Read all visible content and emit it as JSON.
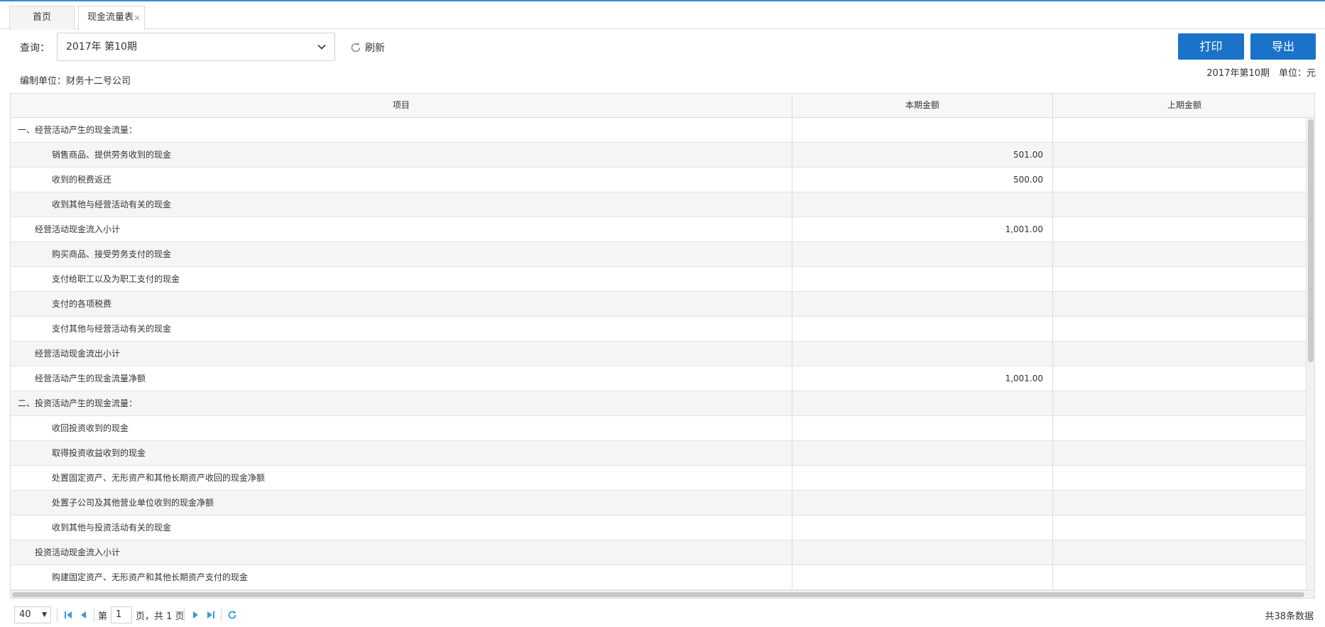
{
  "tabs": [
    {
      "label": "首页"
    },
    {
      "label": "现金流量表",
      "close": "×"
    }
  ],
  "query": {
    "label": "查询：",
    "selected": "2017年 第10期",
    "refresh_label": "刷新"
  },
  "actions": {
    "print_label": "打印",
    "export_label": "导出"
  },
  "unit_text": "编制单位：财务十二号公司",
  "period_info": "2017年第10期　单位：元",
  "table": {
    "headers": [
      "项目",
      "本期金额",
      "上期金额"
    ],
    "rows": [
      {
        "item": "一、经营活动产生的现金流量：",
        "level": 0,
        "current": "",
        "previous": ""
      },
      {
        "item": "销售商品、提供劳务收到的现金",
        "level": 2,
        "current": "501.00",
        "previous": ""
      },
      {
        "item": "收到的税费返还",
        "level": 2,
        "current": "500.00",
        "previous": ""
      },
      {
        "item": "收到其他与经营活动有关的现金",
        "level": 2,
        "current": "",
        "previous": ""
      },
      {
        "item": "经营活动现金流入小计",
        "level": 1,
        "current": "1,001.00",
        "previous": ""
      },
      {
        "item": "购买商品、接受劳务支付的现金",
        "level": 2,
        "current": "",
        "previous": ""
      },
      {
        "item": "支付给职工以及为职工支付的现金",
        "level": 2,
        "current": "",
        "previous": ""
      },
      {
        "item": "支付的各项税费",
        "level": 2,
        "current": "",
        "previous": ""
      },
      {
        "item": "支付其他与经营活动有关的现金",
        "level": 2,
        "current": "",
        "previous": ""
      },
      {
        "item": "经营活动现金流出小计",
        "level": 1,
        "current": "",
        "previous": ""
      },
      {
        "item": "经营活动产生的现金流量净额",
        "level": 1,
        "current": "1,001.00",
        "previous": ""
      },
      {
        "item": "二、投资活动产生的现金流量：",
        "level": 0,
        "current": "",
        "previous": ""
      },
      {
        "item": "收回投资收到的现金",
        "level": 2,
        "current": "",
        "previous": ""
      },
      {
        "item": "取得投资收益收到的现金",
        "level": 2,
        "current": "",
        "previous": ""
      },
      {
        "item": "处置固定资产、无形资产和其他长期资产收回的现金净额",
        "level": 2,
        "current": "",
        "previous": ""
      },
      {
        "item": "处置子公司及其他营业单位收到的现金净额",
        "level": 2,
        "current": "",
        "previous": ""
      },
      {
        "item": "收到其他与投资活动有关的现金",
        "level": 2,
        "current": "",
        "previous": ""
      },
      {
        "item": "投资活动现金流入小计",
        "level": 1,
        "current": "",
        "previous": ""
      },
      {
        "item": "购建固定资产、无形资产和其他长期资产支付的现金",
        "level": 2,
        "current": "",
        "previous": ""
      }
    ]
  },
  "pager": {
    "page_size": "40",
    "page_prefix": "第",
    "page_number": "1",
    "page_suffix": "页，共 1 页",
    "total_text": "共38条数据"
  },
  "colors": {
    "accent": "#1a73c9",
    "topline": "#2f8fd8",
    "pager_icon": "#3a9ad9"
  }
}
